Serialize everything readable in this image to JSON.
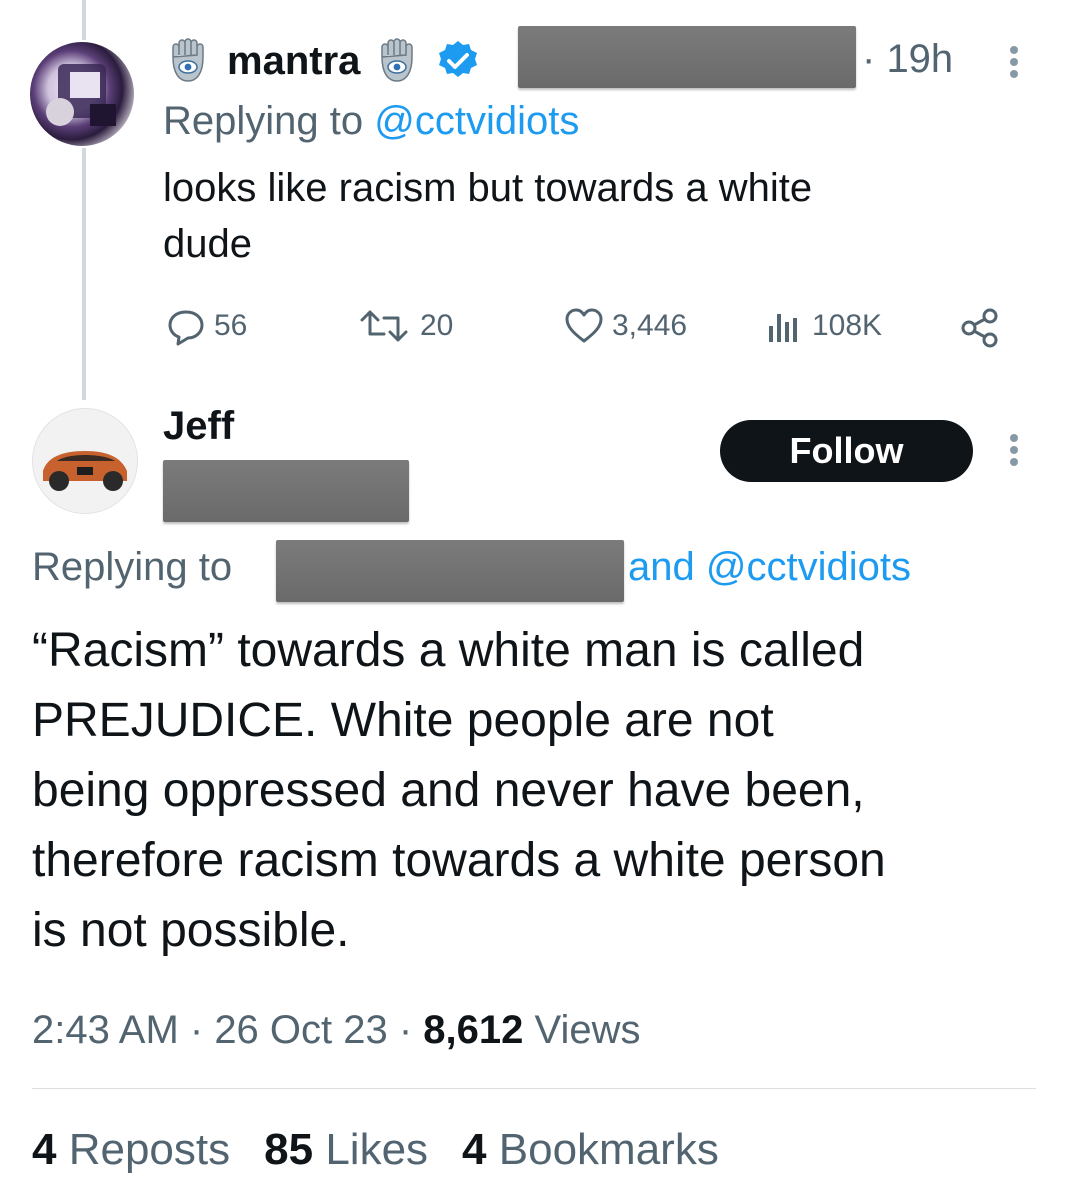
{
  "first_tweet": {
    "author_name": "mantra",
    "time": "19h",
    "replying_label": "Replying to",
    "replying_handle": "@cctvidiots",
    "text_line1": "looks like racism but towards a white",
    "text_line2": "dude",
    "actions": {
      "replies": "56",
      "reposts": "20",
      "likes": "3,446",
      "views": "108K"
    },
    "icons": [
      "hamsa-icon",
      "verified-badge-icon",
      "more-options-icon",
      "reply-icon",
      "repost-icon",
      "like-icon",
      "views-icon",
      "share-icon"
    ],
    "verified_color": "#1d9bf0"
  },
  "second_tweet": {
    "author_name": "Jeff",
    "follow_label": "Follow",
    "replying_label": "Replying to",
    "replying_suffix": "and @cctvidiots",
    "body_lines": [
      "“Racism” towards a white man is called",
      "PREJUDICE. White people are not",
      "being oppressed and never have been,",
      "therefore racism towards a white person",
      "is not possible."
    ],
    "meta": {
      "time": "2:43 AM",
      "date": "26 Oct 23",
      "views_count": "8,612",
      "views_label": "Views"
    },
    "stats": {
      "reposts_count": "4",
      "reposts_label": "Reposts",
      "likes_count": "85",
      "likes_label": "Likes",
      "bookmarks_count": "4",
      "bookmarks_label": "Bookmarks"
    }
  },
  "colors": {
    "link": "#1d9bf0",
    "muted": "#536471",
    "text": "#0f1419",
    "button_bg": "#0f1419"
  }
}
